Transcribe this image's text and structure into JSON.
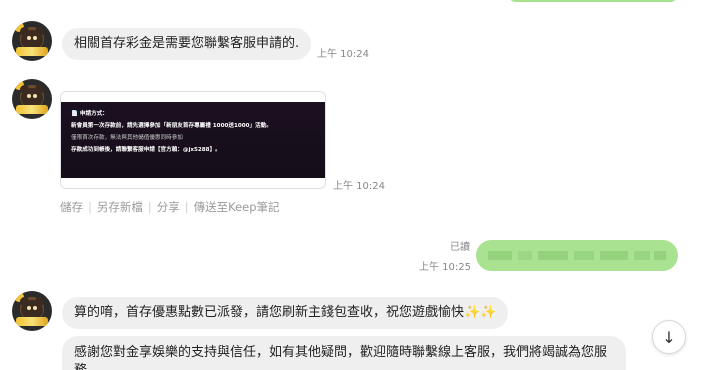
{
  "messages": [
    {
      "text": "相關首存彩金是需要您聯繫客服申請的.",
      "time": "上午 10:24"
    },
    {
      "image_lines": [
        "📄 申請方式：",
        "新會員第一次存款前，請先選擇參加「新朋友首存專屬禮 1000送1000」活動。",
        "僅限首次存款，無法與其他儲值優惠同時參加",
        "存款成功到帳後，請聯繫客服申請【官方賴：@jx5288】。"
      ],
      "time": "上午 10:24",
      "actions": [
        "儲存",
        "另存新檔",
        "分享",
        "傳送至Keep筆記"
      ]
    },
    {
      "read": "已讀",
      "time": "上午 10:25"
    },
    {
      "text": "算的唷，首存優惠點數已派發，請您刷新主錢包查收，祝您遊戲愉快✨✨"
    },
    {
      "text": "感謝您對金享娛樂的支持與信任，如有其他疑問，歡迎隨時聯繫線上客服，我們將竭誠為您服務"
    }
  ],
  "icons": {
    "scroll_down": "↓"
  },
  "colors": {
    "own_bubble": "#a9e391",
    "other_bubble": "#efefef"
  }
}
